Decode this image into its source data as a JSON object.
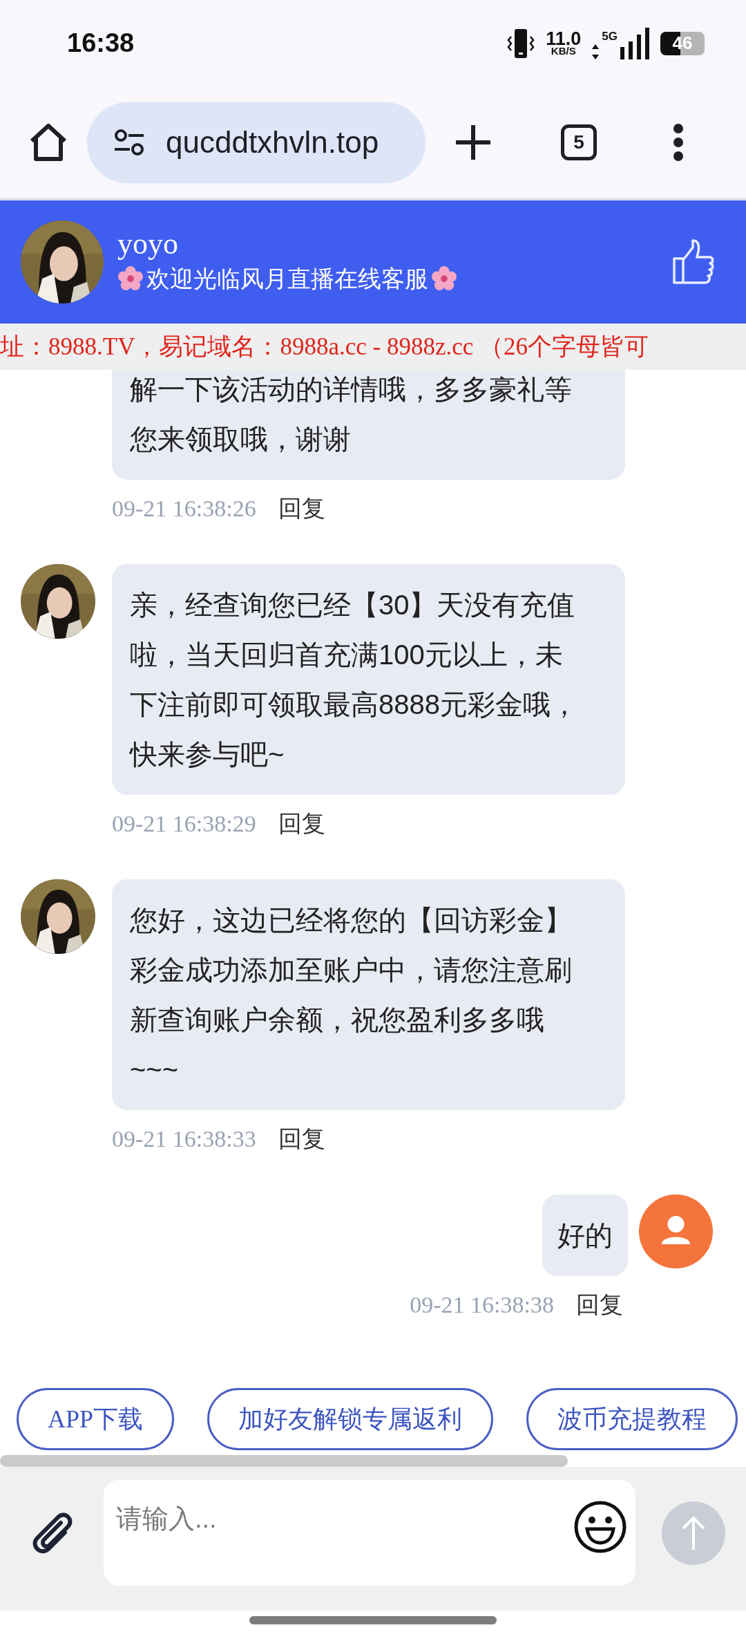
{
  "status_bar": {
    "time": "16:38",
    "net_speed": "11.0",
    "net_unit": "KB/S",
    "network": "5G",
    "battery": "46"
  },
  "browser": {
    "url": "qucddtxhvln.top",
    "tab_count": "5"
  },
  "header": {
    "name": "yoyo",
    "subtitle": "欢迎光临风月直播在线客服"
  },
  "notice": "址：8988.TV，易记域名：8988a.cc - 8988z.cc （26个字母皆可",
  "messages": [
    {
      "kind": "agent",
      "text": "解一下该活动的详情哦，多多豪礼等您来领取哦，谢谢",
      "time": "09-21 16:38:26",
      "reply": "回复"
    },
    {
      "kind": "agent",
      "text": "亲，经查询您已经【30】天没有充值啦，当天回归首充满100元以上，未下注前即可领取最高8888元彩金哦，快来参与吧~",
      "time": "09-21 16:38:29",
      "reply": "回复"
    },
    {
      "kind": "agent",
      "text": "您好，这边已经将您的【回访彩金】彩金成功添加至账户中，请您注意刷新查询账户余额，祝您盈利多多哦~~~",
      "time": "09-21 16:38:33",
      "reply": "回复"
    },
    {
      "kind": "user",
      "text": "好的",
      "time": "09-21 16:38:38",
      "reply": "回复"
    }
  ],
  "quick_actions": [
    "APP下载",
    "加好友解锁专属返利",
    "波币充提教程"
  ],
  "composer": {
    "placeholder": "请输入..."
  }
}
